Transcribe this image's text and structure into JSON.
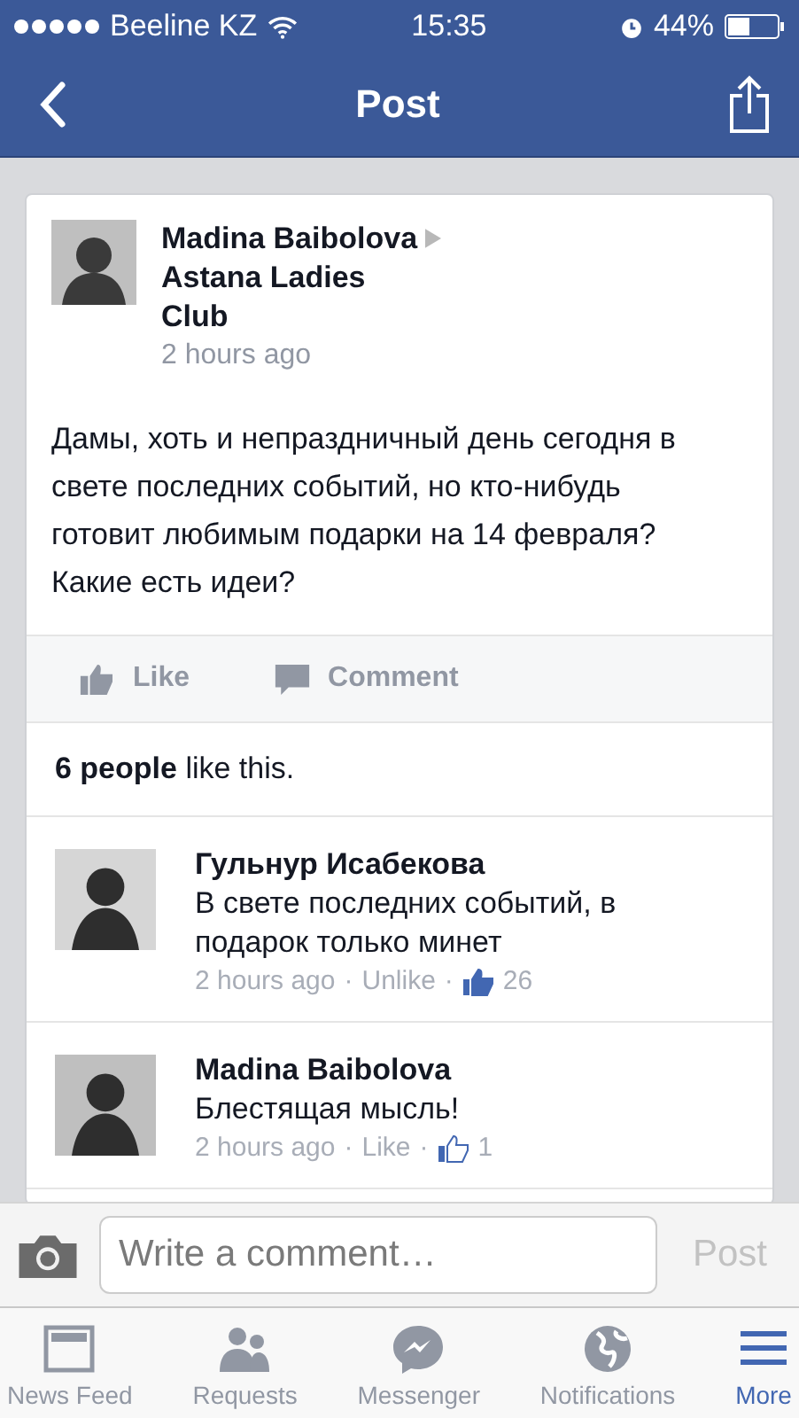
{
  "status_bar": {
    "carrier": "Beeline KZ",
    "time": "15:35",
    "battery": "44%"
  },
  "nav": {
    "title": "Post"
  },
  "post": {
    "author": "Madina  Baibolova",
    "group": "Astana Ladies Club",
    "time": "2 hours ago",
    "text": "Дамы, хоть и непраздничный день сегодня в свете последних событий, но кто-нибудь готовит любимым подарки на 14 февраля? Какие есть идеи?",
    "actions": [
      "Like",
      "Comment"
    ],
    "likes": "**6 people** like this."
  },
  "comments": [
    {
      "author": "Гульнур Исабекова",
      "text": "В свете последних событий, в подарок только минет",
      "time": "2 hours ago",
      "action": "Unlike",
      "liked": true,
      "count": "26"
    },
    {
      "author": "Madina  Baibolova",
      "text": "Блестящая мысль!",
      "time": "2 hours ago",
      "action": "Like",
      "liked": false,
      "count": "1"
    }
  ],
  "comment_separator": "·",
  "composer": {
    "placeholder": "Write a comment…",
    "post_button": "Post"
  },
  "tabs": [
    {
      "label": "News Feed",
      "kind": "feed",
      "selected": false
    },
    {
      "label": "Requests",
      "kind": "requests",
      "selected": false
    },
    {
      "label": "Messenger",
      "kind": "messenger",
      "selected": false
    },
    {
      "label": "Notifications",
      "kind": "globe",
      "selected": false
    },
    {
      "label": "More",
      "kind": "menu",
      "selected": true
    }
  ]
}
